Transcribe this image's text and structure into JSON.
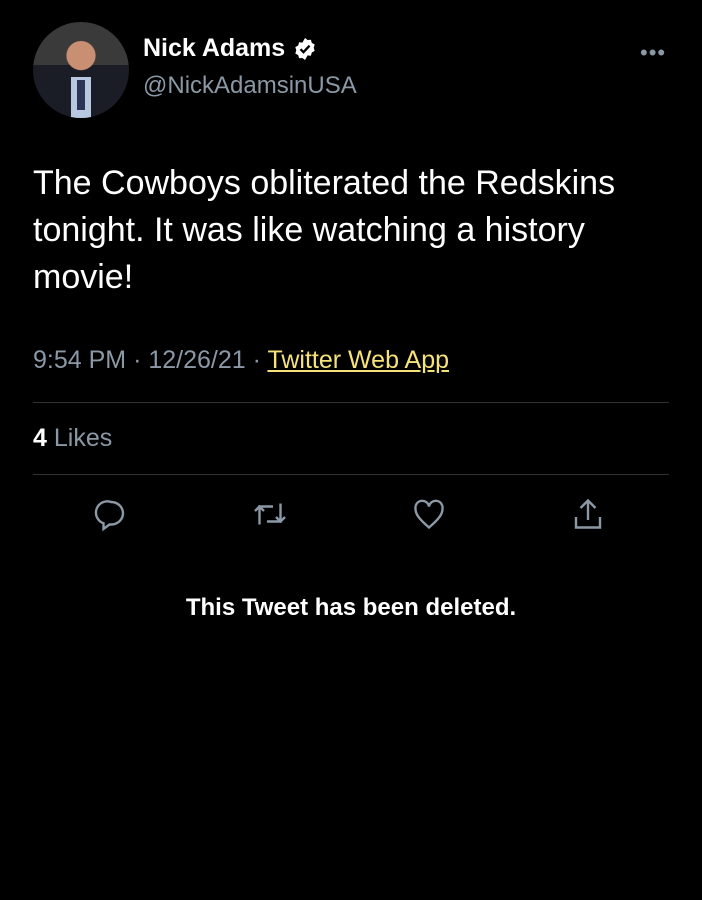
{
  "user": {
    "name": "Nick Adams",
    "handle": "@NickAdamsinUSA",
    "verified": true
  },
  "tweet": {
    "text": "The Cowboys obliterated the Redskins tonight. It was like watching a history movie!",
    "time": "9:54 PM",
    "date": "12/26/21",
    "separator": "·",
    "source": "Twitter Web App",
    "likes_count": "4",
    "likes_label": "Likes"
  },
  "actions": [
    "reply-icon",
    "retweet-icon",
    "like-icon",
    "share-icon"
  ],
  "notice": "This Tweet has been deleted.",
  "colors": {
    "background": "#000000",
    "source_link": "#f5e27a",
    "muted": "#8b98a5"
  }
}
